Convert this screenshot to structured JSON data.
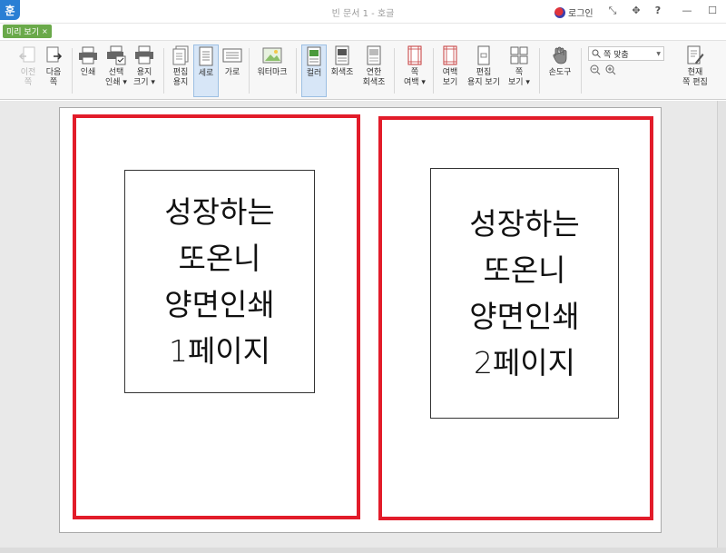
{
  "window": {
    "app_logo": "훈",
    "title": "빈 문서 1 - 호글",
    "login_label": "로그인",
    "controls": [
      "⤡",
      "✥",
      "?",
      "—",
      "☐"
    ]
  },
  "tab": {
    "label": "미리 보기",
    "close": "×"
  },
  "toolbar": {
    "prev_page": "이전\n쪽",
    "next_page": "다음\n쪽",
    "print": "인쇄",
    "select_print": "선택\n인쇄 ▾",
    "paper_size": "용지\n크기 ▾",
    "edit_paper": "편집\n용지",
    "portrait": "세로",
    "landscape": "가로",
    "watermark": "워터마크",
    "color": "컬러",
    "grayscale": "회색조",
    "light_grayscale": "연한\n회색조",
    "page_margin": "쪽\n여백 ▾",
    "margin_view": "여백\n보기",
    "edit_paper_view": "편집\n용지 보기",
    "page_view": "쪽\n보기 ▾",
    "hand_tool": "손도구",
    "zoom_value": "쪽 맞춤",
    "current_page_edit": "현재\n쪽 편집"
  },
  "pages": [
    {
      "lines": [
        "성장하는",
        "또온니",
        "양면인쇄",
        "1페이지"
      ]
    },
    {
      "lines": [
        "성장하는",
        "또온니",
        "양면인쇄",
        "2페이지"
      ]
    }
  ],
  "colors": {
    "highlight_border": "#e21c2a",
    "tab_green": "#6aa94a",
    "logo_blue": "#2a7fd4",
    "active_button": "#d7e6f7"
  }
}
